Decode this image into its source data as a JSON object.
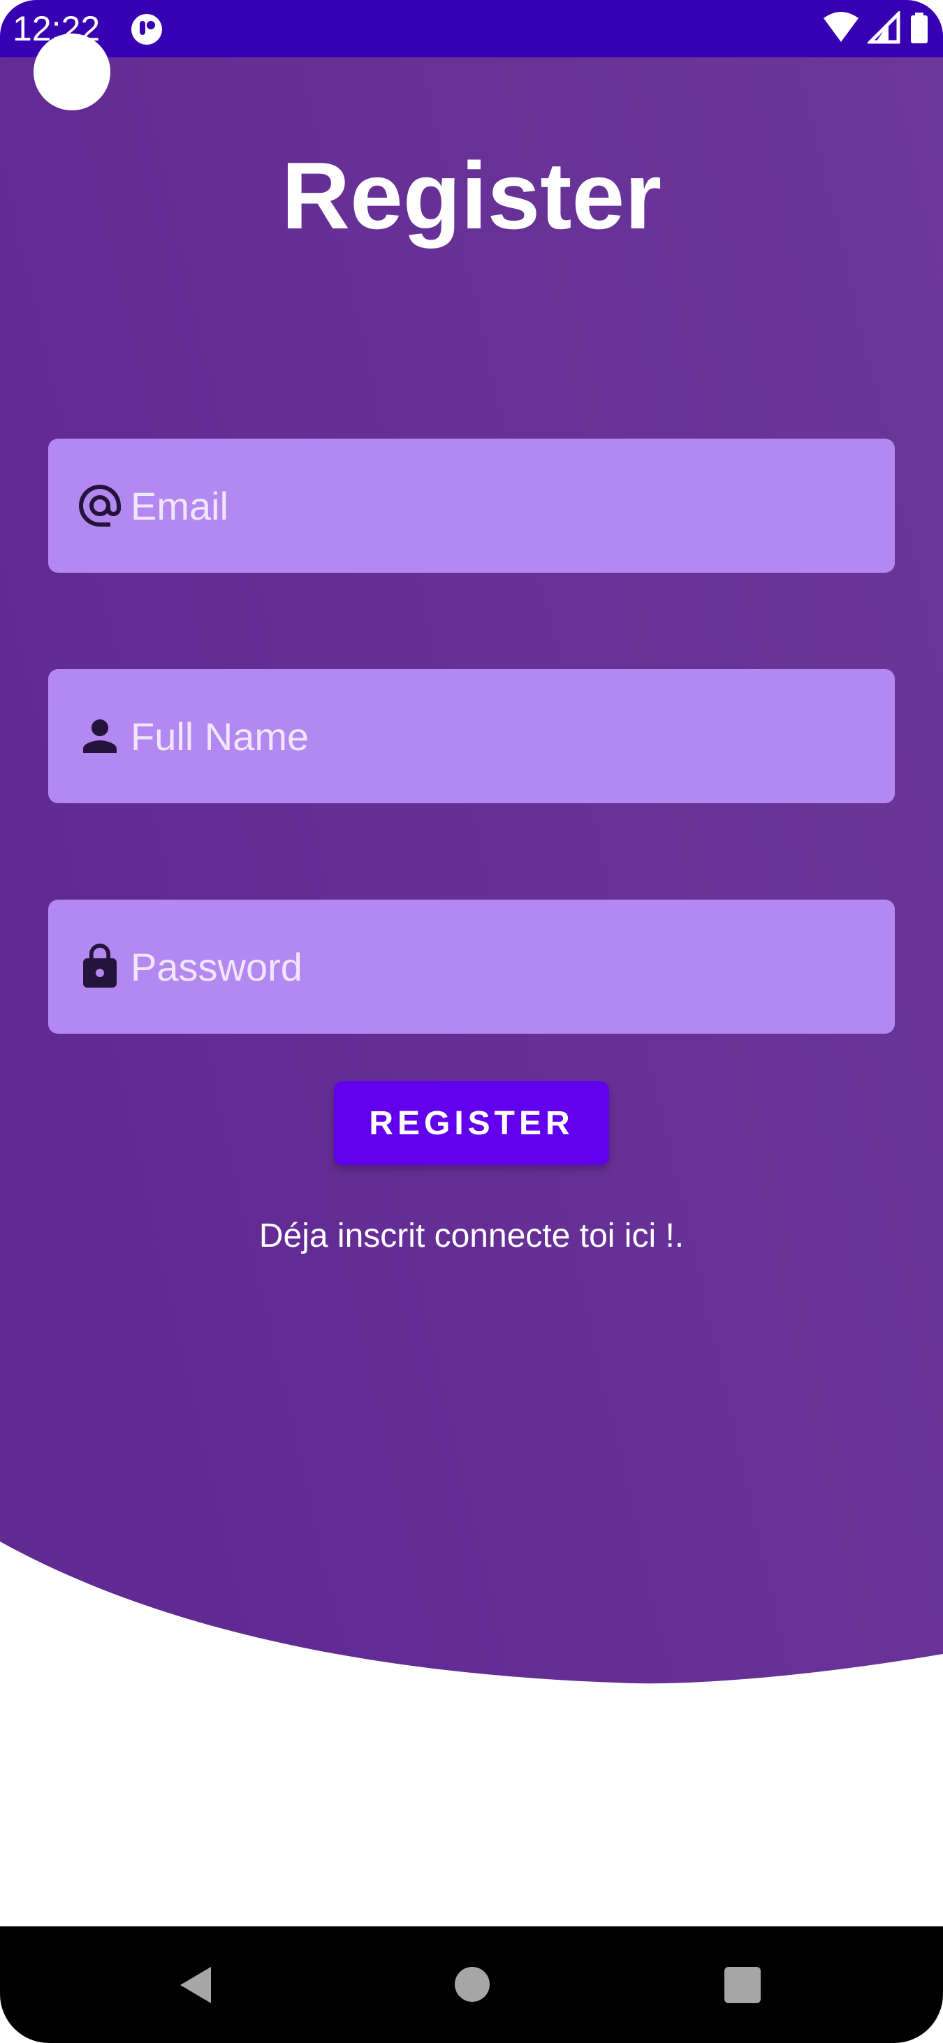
{
  "status_bar": {
    "time": "12:22",
    "app_icon": "app-notification-icon",
    "wifi_icon": "wifi-icon",
    "signal_icon": "signal-icon",
    "battery_icon": "battery-icon"
  },
  "screen": {
    "title": "Register"
  },
  "form": {
    "email": {
      "placeholder": "Email",
      "value": "",
      "icon": "at-sign-icon"
    },
    "full_name": {
      "placeholder": "Full Name",
      "value": "",
      "icon": "person-icon"
    },
    "password": {
      "placeholder": "Password",
      "value": "",
      "icon": "lock-icon"
    },
    "register_label": "REGISTER",
    "login_link": "Déja inscrit connecte toi ici !."
  },
  "nav_bar": {
    "back_icon": "back-icon",
    "home_icon": "home-icon",
    "recents_icon": "recents-icon"
  },
  "colors": {
    "status_bar": "#3700b3",
    "background_purple": "#612a93",
    "field_fill": "#b388f0",
    "button": "#6200ee",
    "text_white": "#ffffff"
  }
}
